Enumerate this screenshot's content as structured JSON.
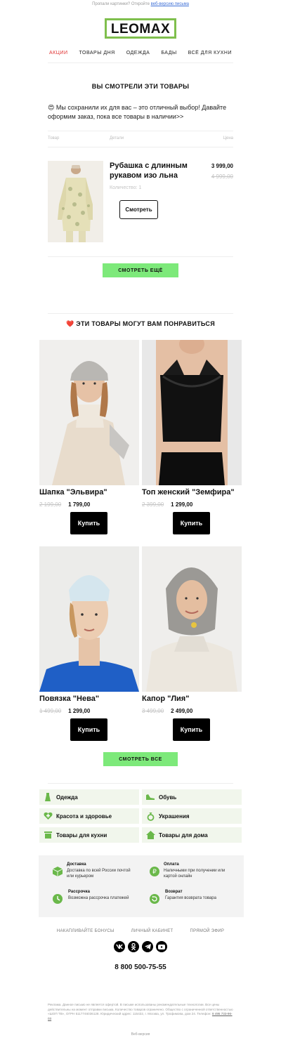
{
  "preheader": {
    "text": "Пропали картинки? Откройте",
    "link": "веб-версию письма"
  },
  "logo": "LEOMAX",
  "nav": [
    "АКЦИИ",
    "ТОВАРЫ ДНЯ",
    "ОДЕЖДА",
    "БАДЫ",
    "ВСЁ ДЛЯ КУХНИ"
  ],
  "viewed": {
    "title": "ВЫ СМОТРЕЛИ ЭТИ ТОВАРЫ",
    "intro": "😍 Мы сохранили их для вас – это отличный выбор! Давайте оформим заказ, пока все товары в наличии>>",
    "columns": [
      "Товар",
      "Детали",
      "Цена"
    ],
    "item": {
      "name": "Рубашка с длинным рукавом изо льна",
      "qty": "Количество: 1",
      "price": "3 999,00",
      "old_price": "4 999,00",
      "button": "Смотреть"
    },
    "more_button": "СМОТРЕТЬ ЕЩЁ"
  },
  "recommend": {
    "title": "❤️ ЭТИ ТОВАРЫ МОГУТ ВАМ ПОНРАВИТЬСЯ",
    "products": [
      {
        "name": "Шапка \"Эльвира\"",
        "old": "2 199,00",
        "price": "1 799,00",
        "button": "Купить"
      },
      {
        "name": "Топ женский \"Земфира\"",
        "old": "2 399,00",
        "price": "1 299,00",
        "button": "Купить"
      },
      {
        "name": "Повязка \"Нева\"",
        "old": "1 499,00",
        "price": "1 299,00",
        "button": "Купить"
      },
      {
        "name": "Капор \"Лия\"",
        "old": "3 499,00",
        "price": "2 499,00",
        "button": "Купить"
      }
    ],
    "all_button": "СМОТРЕТЬ ВСЕ"
  },
  "categories": [
    "Одежда",
    "Обувь",
    "Красота и здоровье",
    "Украшения",
    "Товары для кухни",
    "Товары для дома"
  ],
  "info": [
    {
      "title": "Доставка",
      "text": "Доставка по всей России почтой или курьером"
    },
    {
      "title": "Оплата",
      "text": "Наличными при получении или картой онлайн"
    },
    {
      "title": "Рассрочка",
      "text": "Возможна рассрочка платежей"
    },
    {
      "title": "Возврат",
      "text": "Гарантия возврата товара"
    }
  ],
  "footer_links": [
    "НАКАПЛИВАЙТЕ БОНУСЫ",
    "ЛИЧНЫЙ КАБИНЕТ",
    "ПРЯМОЙ ЭФИР"
  ],
  "phone": "8 800 500-75-55",
  "legal": {
    "text": "Реклама. Данное письмо не является офертой. В письме использованы рекомендательные технологии. Все цены действительны на момент отправки письма. Количество товаров ограничено. Общество с ограниченной ответственностью «ШОП ТВ», ОГРН 5117746036128. Юридический адрес: 115432, г. Москва, ул. Трофимова, дом 24. Телефон:",
    "phone": "8 495 733-96-03"
  },
  "web_version": "Веб-версия",
  "colors": {
    "accent_green": "#7de97a",
    "logo_border": "#7fbf4d",
    "nav_active": "#e03030",
    "category_bg": "#f1f6ec"
  }
}
